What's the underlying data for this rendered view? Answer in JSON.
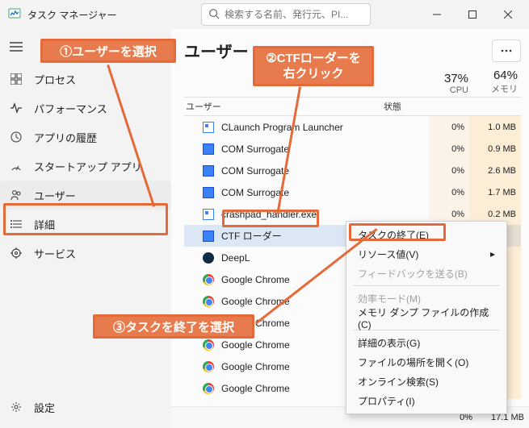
{
  "window": {
    "title": "タスク マネージャー"
  },
  "search": {
    "placeholder": "検索する名前、発行元、PI..."
  },
  "sidebar": {
    "items": [
      {
        "label": "プロセス"
      },
      {
        "label": "パフォーマンス"
      },
      {
        "label": "アプリの履歴"
      },
      {
        "label": "スタートアップ アプリ"
      },
      {
        "label": "ユーザー"
      },
      {
        "label": "詳細"
      },
      {
        "label": "サービス"
      }
    ],
    "settings_label": "設定"
  },
  "main": {
    "title": "ユーザー",
    "columns": {
      "name_header": "ユーザー",
      "status_header": "状態",
      "cpu": {
        "pct": "37%",
        "label": "CPU"
      },
      "mem": {
        "pct": "64%",
        "label": "メモリ"
      }
    },
    "processes": [
      {
        "name": "CLaunch Program Launcher",
        "cpu": "0%",
        "mem": "1.0 MB",
        "icon": "exe"
      },
      {
        "name": "COM Surrogate",
        "cpu": "0%",
        "mem": "0.9 MB",
        "icon": "blue"
      },
      {
        "name": "COM Surrogate",
        "cpu": "0%",
        "mem": "2.6 MB",
        "icon": "blue"
      },
      {
        "name": "COM Surrogate",
        "cpu": "0%",
        "mem": "1.7 MB",
        "icon": "blue"
      },
      {
        "name": "crashpad_handler.exe",
        "cpu": "0%",
        "mem": "0.2 MB",
        "icon": "exe"
      },
      {
        "name": "CTF ローダー",
        "cpu": "",
        "mem": "",
        "icon": "blue",
        "selected": true
      },
      {
        "name": "DeepL",
        "cpu": "",
        "mem": "",
        "icon": "deepl"
      },
      {
        "name": "Google Chrome",
        "cpu": "",
        "mem": "",
        "icon": "chrome"
      },
      {
        "name": "Google Chrome",
        "cpu": "",
        "mem": "",
        "icon": "chrome"
      },
      {
        "name": "Google Chrome",
        "cpu": "",
        "mem": "",
        "icon": "chrome"
      },
      {
        "name": "Google Chrome",
        "cpu": "",
        "mem": "",
        "icon": "chrome"
      },
      {
        "name": "Google Chrome",
        "cpu": "",
        "mem": "",
        "icon": "chrome"
      },
      {
        "name": "Google Chrome",
        "cpu": "",
        "mem": "",
        "icon": "chrome"
      }
    ],
    "footer": {
      "cpu": "0%",
      "mem": "17.1 MB"
    }
  },
  "context_menu": {
    "items": [
      {
        "label": "タスクの終了(E)",
        "disabled": false
      },
      {
        "label": "リソース値(V)",
        "disabled": false,
        "submenu": true
      },
      {
        "label": "フィードバックを送る(B)",
        "disabled": true
      },
      {
        "sep": true
      },
      {
        "label": "効率モード(M)",
        "disabled": true
      },
      {
        "label": "メモリ ダンプ ファイルの作成(C)",
        "disabled": false
      },
      {
        "sep": true
      },
      {
        "label": "詳細の表示(G)",
        "disabled": false
      },
      {
        "label": "ファイルの場所を開く(O)",
        "disabled": false
      },
      {
        "label": "オンライン検索(S)",
        "disabled": false
      },
      {
        "label": "プロパティ(I)",
        "disabled": false
      }
    ]
  },
  "annotations": {
    "a1": "①ユーザーを選択",
    "a2_line1": "②CTFローダーを",
    "a2_line2": "右クリック",
    "a3": "③タスクを終了を選択"
  }
}
